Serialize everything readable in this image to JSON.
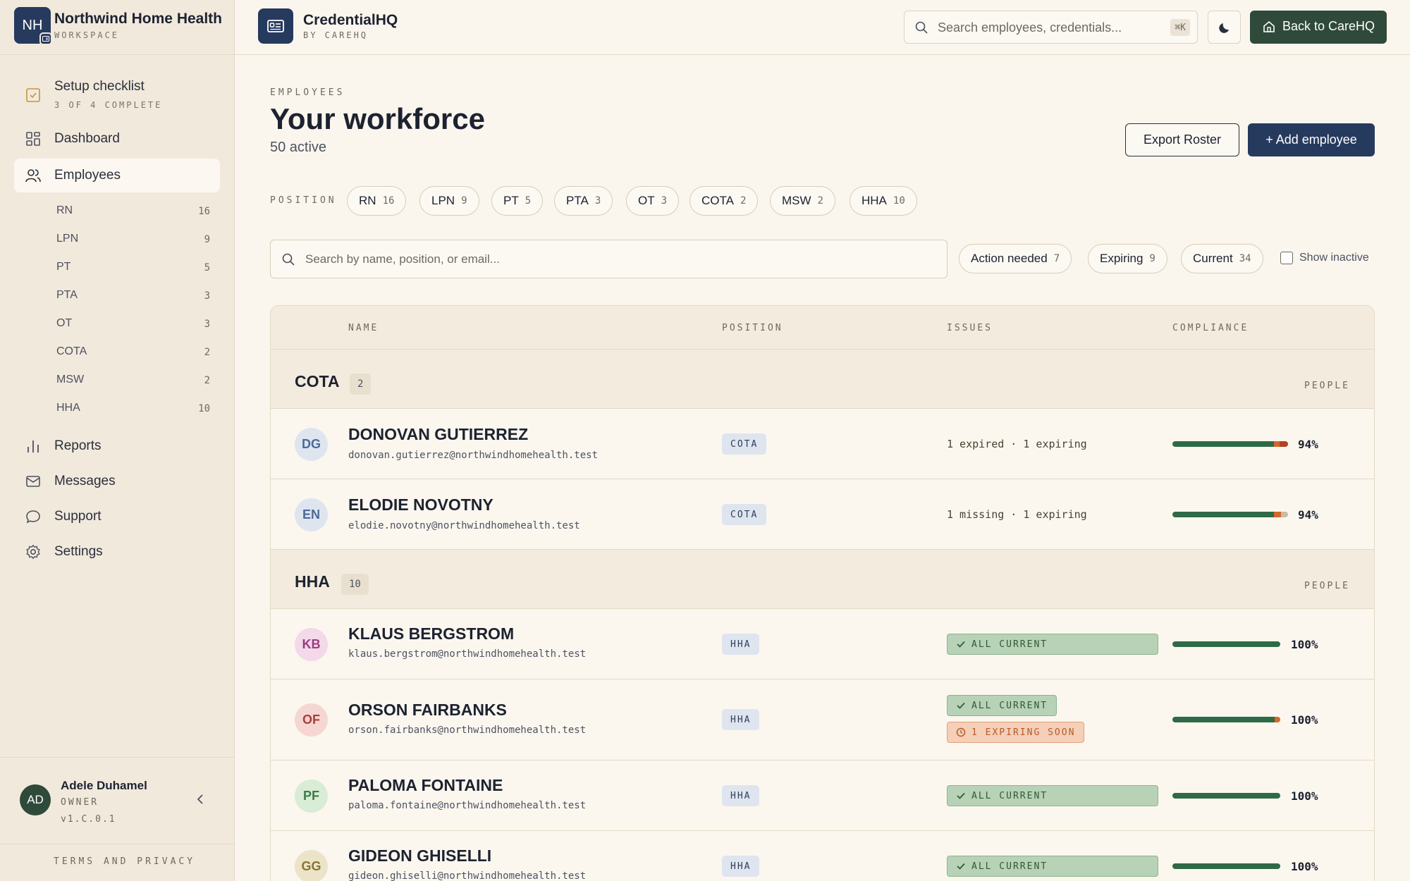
{
  "workspace": {
    "initials": "NH",
    "name": "Northwind Home Health",
    "subtitle": "WORKSPACE"
  },
  "app": {
    "name": "CredentialHQ",
    "subtitle": "BY CAREHQ"
  },
  "topbar": {
    "search_placeholder": "Search employees, credentials...",
    "search_shortcut": "⌘K",
    "theme_icon": "moon-icon",
    "back_label": "Back to CareHQ"
  },
  "sidebar": {
    "setup": {
      "label": "Setup checklist",
      "progress": "3 OF 4 COMPLETE"
    },
    "nav": {
      "dashboard": "Dashboard",
      "employees": "Employees",
      "reports": "Reports",
      "messages": "Messages",
      "support": "Support",
      "settings": "Settings"
    },
    "positions": [
      {
        "label": "RN",
        "count": "16"
      },
      {
        "label": "LPN",
        "count": "9"
      },
      {
        "label": "PT",
        "count": "5"
      },
      {
        "label": "PTA",
        "count": "3"
      },
      {
        "label": "OT",
        "count": "3"
      },
      {
        "label": "COTA",
        "count": "2"
      },
      {
        "label": "MSW",
        "count": "2"
      },
      {
        "label": "HHA",
        "count": "10"
      }
    ],
    "user": {
      "initials": "AD",
      "name": "Adele Duhamel",
      "role": "OWNER",
      "version": "v1.C.0.1"
    },
    "terms": "TERMS AND PRIVACY"
  },
  "page": {
    "eyebrow": "EMPLOYEES",
    "title": "Your workforce",
    "subtitle": "50 active",
    "export_label": "Export Roster",
    "add_label": "+ Add employee"
  },
  "filters": {
    "position_label": "POSITION",
    "chips": [
      {
        "label": "RN",
        "count": "16"
      },
      {
        "label": "LPN",
        "count": "9"
      },
      {
        "label": "PT",
        "count": "5"
      },
      {
        "label": "PTA",
        "count": "3"
      },
      {
        "label": "OT",
        "count": "3"
      },
      {
        "label": "COTA",
        "count": "2"
      },
      {
        "label": "MSW",
        "count": "2"
      },
      {
        "label": "HHA",
        "count": "10"
      }
    ],
    "search_placeholder": "Search by name, position, or email...",
    "status": [
      {
        "label": "Action needed",
        "count": "7"
      },
      {
        "label": "Expiring",
        "count": "9"
      },
      {
        "label": "Current",
        "count": "34"
      }
    ],
    "show_inactive": "Show inactive"
  },
  "table": {
    "headers": {
      "name": "NAME",
      "position": "POSITION",
      "issues": "ISSUES",
      "compliance": "COMPLIANCE"
    },
    "people_label": "PEOPLE",
    "groups": [
      {
        "name": "COTA",
        "count": "2",
        "rows": [
          {
            "initials": "DG",
            "name": "DONOVAN GUTIERREZ",
            "email": "donovan.gutierrez@northwindhomehealth.test",
            "position": "COTA",
            "issues": "1 expired · 1 expiring",
            "compliance": "94%",
            "compliance_value": 94
          },
          {
            "initials": "EN",
            "name": "ELODIE NOVOTNY",
            "email": "elodie.novotny@northwindhomehealth.test",
            "position": "COTA",
            "issues": "1 missing · 1 expiring",
            "compliance": "94%",
            "compliance_value": 94
          }
        ]
      },
      {
        "name": "HHA",
        "count": "10",
        "rows": [
          {
            "initials": "KB",
            "name": "KLAUS BERGSTROM",
            "email": "klaus.bergstrom@northwindhomehealth.test",
            "position": "HHA",
            "status": "ALL CURRENT",
            "compliance": "100%",
            "compliance_value": 100
          },
          {
            "initials": "OF",
            "name": "ORSON FAIRBANKS",
            "email": "orson.fairbanks@northwindhomehealth.test",
            "position": "HHA",
            "status": "ALL CURRENT",
            "warning": "1 EXPIRING SOON",
            "compliance": "100%",
            "compliance_value": 100
          },
          {
            "initials": "PF",
            "name": "PALOMA FONTAINE",
            "email": "paloma.fontaine@northwindhomehealth.test",
            "position": "HHA",
            "status": "ALL CURRENT",
            "compliance": "100%",
            "compliance_value": 100
          },
          {
            "initials": "GG",
            "name": "GIDEON GHISELLI",
            "email": "gideon.ghiselli@northwindhomehealth.test",
            "position": "HHA",
            "status": "ALL CURRENT",
            "compliance": "100%",
            "compliance_value": 100
          }
        ]
      }
    ]
  },
  "colors": {
    "navy": "#263a5e",
    "green": "#2f6a47",
    "orange": "#d4682c",
    "cream": "#faf6ee"
  }
}
